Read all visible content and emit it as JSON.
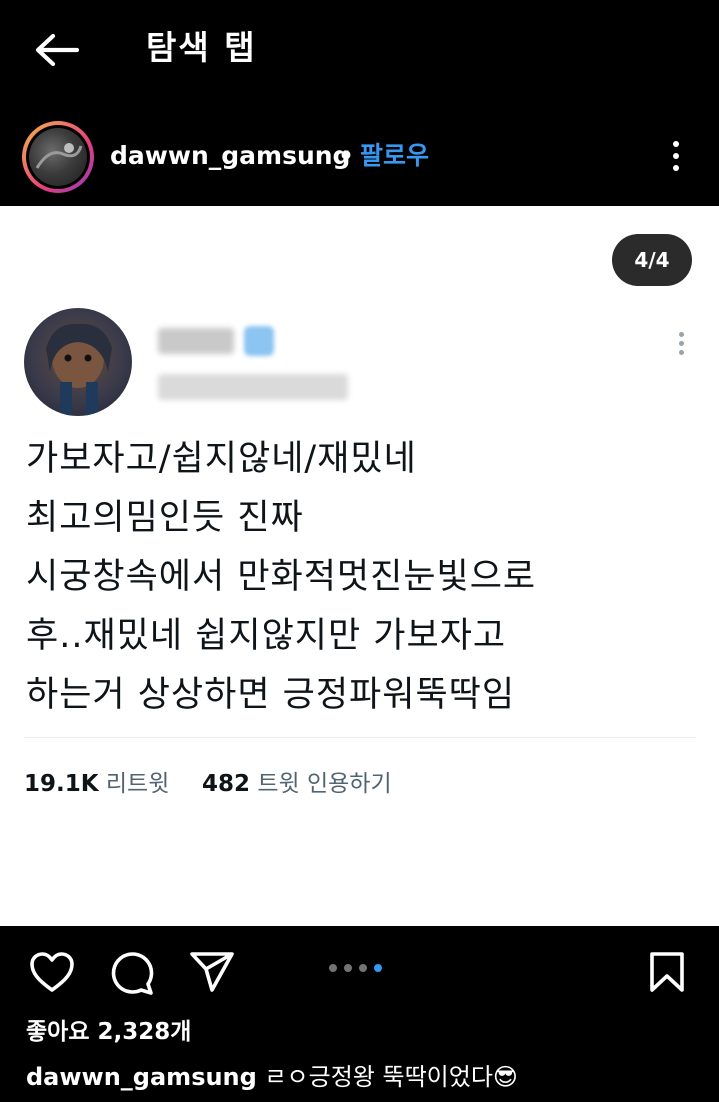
{
  "header": {
    "title": "탐색 탭",
    "back_icon": "arrow-left-icon"
  },
  "post": {
    "username": "dawwn_gamsung",
    "separator": "•",
    "follow_label": "팔로우",
    "more_icon": "more-vertical-icon"
  },
  "media": {
    "page_counter": "4/4",
    "current_page": 4,
    "total_pages": 4,
    "tweet": {
      "lines": [
        "가보자고/쉽지않네/재밌네",
        "최고의밈인듯 진짜",
        "시궁창속에서 만화적멋진눈빛으로",
        "후..재밌네 쉽지않지만 가보자고",
        "하는거 상상하면 긍정파워뚝딱임"
      ],
      "retweet_count": "19.1K",
      "retweet_label": "리트윗",
      "quote_count": "482",
      "quote_label": "트윗 인용하기"
    }
  },
  "actions": {
    "like_icon": "heart-icon",
    "comment_icon": "comment-icon",
    "share_icon": "send-icon",
    "save_icon": "bookmark-icon",
    "carousel_dots": 4,
    "active_dot": 4
  },
  "likes": {
    "label": "좋아요",
    "count": "2,328개"
  },
  "caption": {
    "username": "dawwn_gamsung",
    "text": "ㄹㅇ긍정왕 뚝딱이었다😎"
  },
  "colors": {
    "background": "#000000",
    "accent": "#3897f0",
    "card": "#ffffff"
  }
}
